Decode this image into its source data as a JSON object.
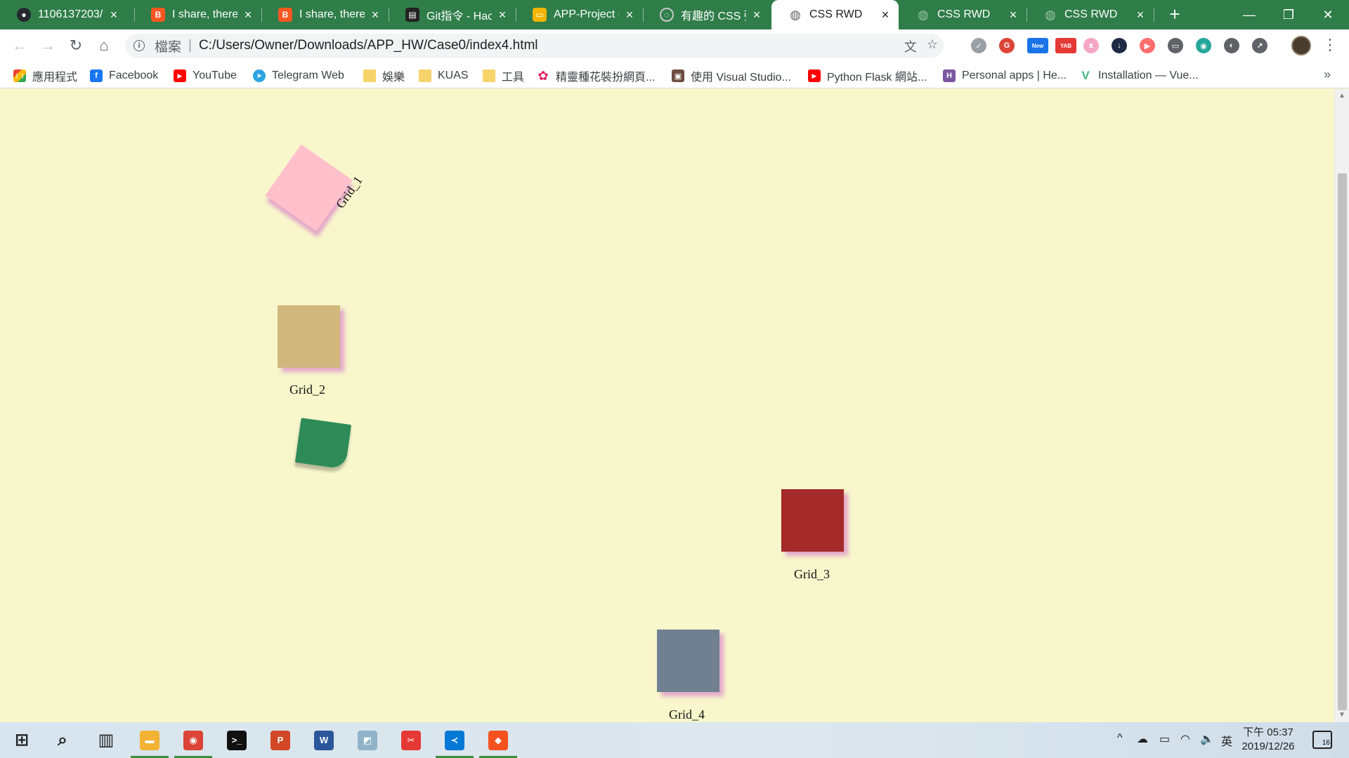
{
  "tabs": [
    {
      "title": "1106137203/",
      "favicon": "github-icon",
      "color": "#24292e",
      "glyph": "●"
    },
    {
      "title": "I share, therefore",
      "favicon": "blogger-icon",
      "color": "#ff5722",
      "glyph": "B"
    },
    {
      "title": "I share, therefore",
      "favicon": "blogger-icon",
      "color": "#ff5722",
      "glyph": "B"
    },
    {
      "title": "Git指令 - Hack",
      "favicon": "document-icon",
      "color": "#222222",
      "glyph": "▤"
    },
    {
      "title": "APP-Project - G",
      "favicon": "slides-icon",
      "color": "#f4b400",
      "glyph": "▭"
    },
    {
      "title": "有趣的 CSS 彈",
      "favicon": "loading-icon",
      "color": "#5f6368",
      "glyph": "◌"
    },
    {
      "title": "CSS RWD",
      "favicon": "globe-icon",
      "color": "#5f6368",
      "glyph": "◍"
    },
    {
      "title": "CSS RWD",
      "favicon": "globe-icon",
      "color": "#5f6368",
      "glyph": "◍"
    },
    {
      "title": "CSS RWD",
      "favicon": "globe-icon",
      "color": "#5f6368",
      "glyph": "◍"
    }
  ],
  "active_tab_index": 6,
  "close_glyph": "×",
  "new_tab_glyph": "+",
  "window_controls": {
    "minimize": "—",
    "maximize": "❐",
    "close": "✕"
  },
  "toolbar": {
    "back": "←",
    "forward": "→",
    "reload": "↻",
    "home": "⌂",
    "info_glyph": "i",
    "scheme_label": "檔案",
    "url": "C:/Users/Owner/Downloads/APP_HW/Case0/index4.html",
    "translate_glyph": "文",
    "star_glyph": "☆",
    "menu_glyph": "⋮"
  },
  "extensions": [
    {
      "name": "check-extension-icon",
      "color": "#9aa0a6",
      "glyph": "✓"
    },
    {
      "name": "google-extension-icon",
      "color": "#db4437",
      "glyph": "G"
    },
    {
      "name": "new-badge-extension-icon",
      "color": "#1a73e8",
      "glyph": "New"
    },
    {
      "name": "yab-extension-icon",
      "color": "#e53935",
      "glyph": "YAB"
    },
    {
      "name": "cat-extension-icon",
      "color": "#f4a7c3",
      "glyph": "ᴥ"
    },
    {
      "name": "download-extension-icon",
      "color": "#1f2a44",
      "glyph": "↓"
    },
    {
      "name": "stream-extension-icon",
      "color": "#ff6d6d",
      "glyph": "▶"
    },
    {
      "name": "chat-extension-icon",
      "color": "#5f6368",
      "glyph": "▭"
    },
    {
      "name": "color-extension-icon",
      "color": "#26a69a",
      "glyph": "◉"
    },
    {
      "name": "palette-extension-icon",
      "color": "#5f6368",
      "glyph": "◐"
    },
    {
      "name": "external-extension-icon",
      "color": "#5f6368",
      "glyph": "↗"
    }
  ],
  "bookmarks": [
    {
      "label": "應用程式",
      "icon": "apps-grid-icon",
      "color": "#4285f4",
      "glyph": "⋮⋮"
    },
    {
      "label": "Facebook",
      "icon": "facebook-icon",
      "color": "#1877f2",
      "glyph": "f"
    },
    {
      "label": "YouTube",
      "icon": "youtube-icon",
      "color": "#ff0000",
      "glyph": "▶"
    },
    {
      "label": "Telegram Web",
      "icon": "telegram-icon",
      "color": "#2ca5e0",
      "glyph": "➤"
    },
    {
      "label": "娛樂",
      "icon": "folder-icon",
      "color": "#f7d46b",
      "glyph": ""
    },
    {
      "label": "KUAS",
      "icon": "folder-icon",
      "color": "#f7d46b",
      "glyph": ""
    },
    {
      "label": "工具",
      "icon": "folder-icon",
      "color": "#f7d46b",
      "glyph": ""
    },
    {
      "label": "精靈種花裝扮網頁...",
      "icon": "flower-icon",
      "color": "#e91e63",
      "glyph": "✿"
    },
    {
      "label": "使用 Visual Studio...",
      "icon": "image-icon",
      "color": "#6d4c41",
      "glyph": "▣"
    },
    {
      "label": "Python Flask 網站...",
      "icon": "youtube-icon",
      "color": "#ff0000",
      "glyph": "▶"
    },
    {
      "label": "Personal apps | He...",
      "icon": "heroku-icon",
      "color": "#79589f",
      "glyph": "H"
    },
    {
      "label": "Installation — Vue...",
      "icon": "vue-icon",
      "color": "#41b883",
      "glyph": "V"
    }
  ],
  "bookmarks_more": "»",
  "page": {
    "background": "#f8f7cc",
    "grids": [
      {
        "name": "grid-1",
        "caption": "Grid_1",
        "color": "#ffc0cb"
      },
      {
        "name": "grid-2",
        "caption": "Grid_2",
        "color": "#d2b77d"
      },
      {
        "name": "grid-5",
        "caption": "",
        "color": "#2e8b57"
      },
      {
        "name": "grid-3",
        "caption": "Grid_3",
        "color": "#a52a2a"
      },
      {
        "name": "grid-4",
        "caption": "Grid_4",
        "color": "#708090"
      }
    ]
  },
  "taskbar": {
    "apps": [
      {
        "name": "start-icon",
        "color": "#1f1f1f",
        "glyph": "⊞",
        "open": false
      },
      {
        "name": "search-icon",
        "color": "#1f1f1f",
        "glyph": "⌕",
        "open": false
      },
      {
        "name": "task-view-icon",
        "color": "#1f1f1f",
        "glyph": "▥",
        "open": false
      },
      {
        "name": "file-explorer-icon",
        "color": "#f2b233",
        "glyph": "▬",
        "open": true
      },
      {
        "name": "chrome-icon",
        "color": "#db4437",
        "glyph": "◉",
        "open": true
      },
      {
        "name": "terminal-icon",
        "color": "#111111",
        "glyph": ">_",
        "open": false
      },
      {
        "name": "powerpoint-icon",
        "color": "#d24726",
        "glyph": "P",
        "open": false
      },
      {
        "name": "word-icon",
        "color": "#2b579a",
        "glyph": "W",
        "open": false
      },
      {
        "name": "notes-icon",
        "color": "#8fb3c9",
        "glyph": "◩",
        "open": false
      },
      {
        "name": "snipping-icon",
        "color": "#e53935",
        "glyph": "✂",
        "open": false
      },
      {
        "name": "vscode-icon",
        "color": "#0078d4",
        "glyph": "≺",
        "open": true
      },
      {
        "name": "git-client-icon",
        "color": "#f4511e",
        "glyph": "◆",
        "open": true
      }
    ],
    "tray": {
      "chevron": "^",
      "cloud": "☁",
      "battery": "▭",
      "wifi": "◠",
      "volume": "🔈",
      "ime": "英",
      "time": "下午 05:37",
      "date": "2019/12/26",
      "notifications": "16"
    }
  }
}
